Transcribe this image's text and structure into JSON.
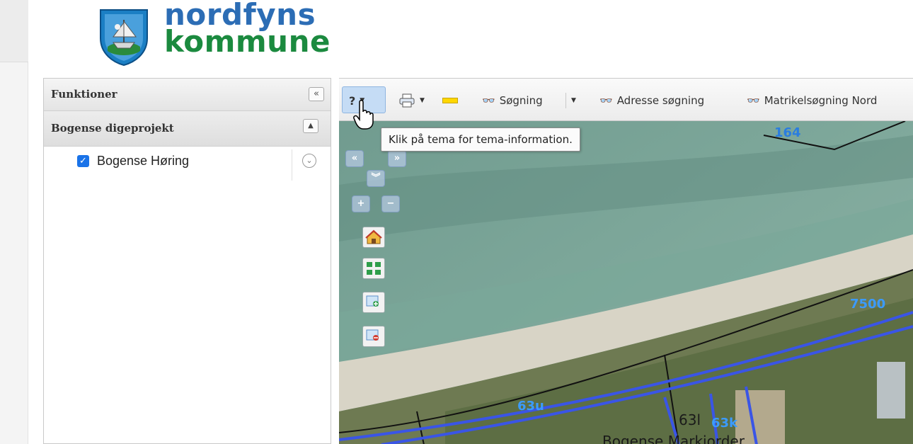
{
  "header": {
    "logo_line1": "nordfyns",
    "logo_line2": "kommune"
  },
  "sidebar": {
    "title": "Funktioner",
    "collapse_label": "«",
    "section_title": "Bogense digeprojekt",
    "layers": [
      {
        "label": "Bogense Høring",
        "checked": true
      }
    ]
  },
  "toolbar": {
    "info_label": "?",
    "search_label": "Søgning",
    "address_search_label": "Adresse søgning",
    "cadastral_search_label": "Matrikelsøgning Nord"
  },
  "tooltip": {
    "text": "Klik på tema for tema-information."
  },
  "map": {
    "nav": {
      "left": "«",
      "right": "»",
      "down": "»",
      "zoom_in": "+",
      "zoom_out": "−"
    },
    "labels": [
      {
        "text": "164",
        "color": "#2a7de0"
      },
      {
        "text": "7500",
        "color": "#3b9bff"
      },
      {
        "text": "63u",
        "color": "#3b9bff"
      },
      {
        "text": "63l",
        "color": "#1a1a1a"
      },
      {
        "text": "63k",
        "color": "#3b9bff"
      },
      {
        "text": "Bogense Markjorder",
        "color": "#1a1a1a"
      }
    ],
    "tools": [
      "home-icon",
      "full-extent-icon",
      "zoom-in-box-icon",
      "zoom-out-box-icon"
    ]
  },
  "colors": {
    "logo_blue": "#2c6db5",
    "logo_green": "#1b8a3f",
    "parcel_blue": "#3a55e6",
    "parcel_black": "#111111"
  }
}
